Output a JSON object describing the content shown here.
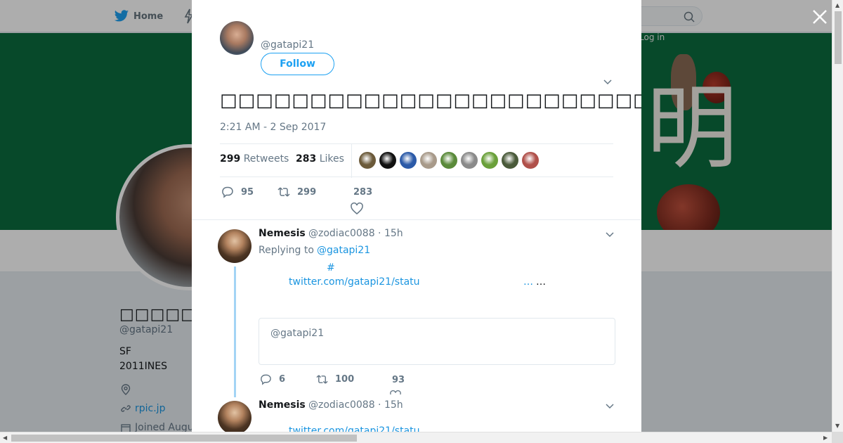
{
  "nav": {
    "home_label": "Home",
    "login_label": "Log in"
  },
  "profile": {
    "name": "□□□□□□□□",
    "handle": "@gatapi21",
    "bio_line1": "SF",
    "bio_line2": "2011INES",
    "url": "rpic.jp",
    "joined": "Joined Augu"
  },
  "tweet": {
    "author_handle": "@gatapi21",
    "follow_label": "Follow",
    "text": "□□□□□□□□□□□□□□□□□□□□□□□□□□□□□□□□□□□□□□□□□□□□□□□□□□□□□□",
    "timestamp": "2:21 AM - 2 Sep 2017",
    "retweets_count": "299",
    "retweets_label": "Retweets",
    "likes_count": "283",
    "likes_label": "Likes",
    "actions": {
      "replies": "95",
      "retweets": "299",
      "likes": "283"
    },
    "liker_colors": [
      "#6b5a3a",
      "#111111",
      "#2b5aa8",
      "#a89a8a",
      "#5a8a3a",
      "#8a8a8a",
      "#6aa03a",
      "#4a5a3a",
      "#b0504a"
    ]
  },
  "replies": [
    {
      "name": "Nemesis",
      "meta": "@zodiac0088 · 15h",
      "replying_label": "Replying to",
      "replying_user": "@gatapi21",
      "hashtag": "#",
      "link": "twitter.com/gatapi21/statu",
      "ellipsis_link": "…",
      "ellipsis": "…",
      "quoted_handle": "@gatapi21",
      "actions": {
        "replies": "6",
        "retweets": "100",
        "likes": "93"
      }
    },
    {
      "name": "Nemesis",
      "meta": "@zodiac0088 · 15h",
      "link": "twitter.com/gatapi21/statu"
    }
  ]
}
